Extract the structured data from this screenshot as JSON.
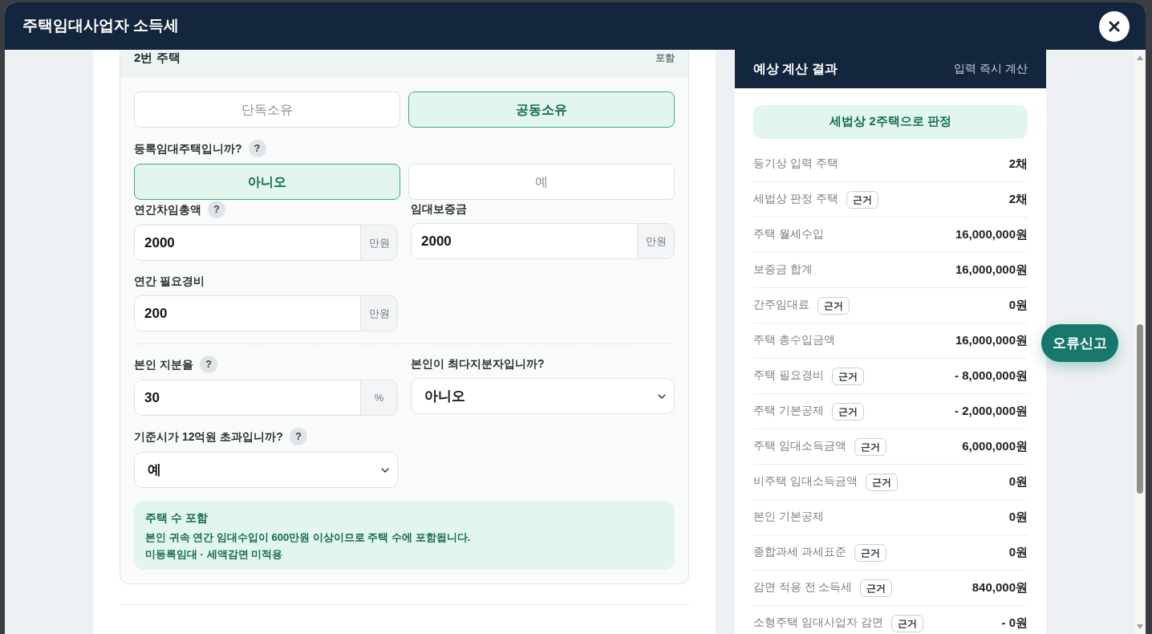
{
  "dialog": {
    "title": "주택임대사업자 소득세"
  },
  "house": {
    "title": "2번 주택",
    "status": "포함",
    "sections": [
      [
        {
          "kind": "toggle",
          "options": [
            {
              "label": "단독소유",
              "selected": false
            },
            {
              "label": "공동소유",
              "selected": true
            }
          ]
        },
        {
          "kind": "toggle",
          "label": "등록임대주택입니까?",
          "help": "?",
          "options": [
            {
              "label": "아니오",
              "selected": true
            },
            {
              "label": "예",
              "selected": false
            }
          ]
        },
        {
          "kind": "number",
          "label": "연간차임총액",
          "help": "?",
          "value": "2000",
          "unit": "만원"
        },
        {
          "kind": "number",
          "label": "임대보증금",
          "value": "2000",
          "unit": "만원"
        },
        {
          "kind": "number",
          "label": "연간 필요경비",
          "value": "200",
          "unit": "만원"
        }
      ],
      [
        {
          "kind": "number",
          "label": "본인 지분율",
          "help": "?",
          "value": "30",
          "unit": "%"
        },
        {
          "kind": "select",
          "label": "본인이 최다지분자입니까?",
          "value": "아니오"
        },
        {
          "kind": "select",
          "label": "기준시가 12억원 초과입니까?",
          "help": "?",
          "value": "예"
        }
      ]
    ],
    "notice": {
      "title": "주택 수 포함",
      "lines": [
        "본인 귀속 연간 임대수입이 600만원 이상이므로 주택 수에 포함됩니다.",
        "미등록임대 · 세액감면 미적용"
      ]
    }
  },
  "result": {
    "title": "예상 계산 결과",
    "note": "입력 즉시 계산",
    "verdict": "세법상 2주택으로 판정",
    "rows": [
      {
        "label": "등기상 입력 주택",
        "value": "2채"
      },
      {
        "label": "세법상 판정 주택",
        "basis": "근거",
        "value": "2채"
      },
      {
        "label": "주택 월세수입",
        "value": "16,000,000원"
      },
      {
        "label": "보증금 합계",
        "value": "16,000,000원"
      },
      {
        "label": "간주임대료",
        "basis": "근거",
        "value": "0원"
      },
      {
        "label": "주택 총수입금액",
        "value": "16,000,000원"
      },
      {
        "label": "주택 필요경비",
        "basis": "근거",
        "value": "- 8,000,000원"
      },
      {
        "label": "주택 기본공제",
        "basis": "근거",
        "value": "- 2,000,000원"
      },
      {
        "label": "주택 임대소득금액",
        "basis": "근거",
        "value": "6,000,000원"
      },
      {
        "label": "비주택 임대소득금액",
        "basis": "근거",
        "value": "0원"
      },
      {
        "label": "본인 기본공제",
        "value": "0원"
      },
      {
        "label": "종합과세 과세표준",
        "basis": "근거",
        "value": "0원"
      },
      {
        "label": "감면 적용 전 소득세",
        "basis": "근거",
        "value": "840,000원"
      },
      {
        "label": "소형주택 임대사업자 감면",
        "basis": "근거",
        "value": "- 0원"
      }
    ]
  },
  "report_button": {
    "label": "오류신고"
  }
}
